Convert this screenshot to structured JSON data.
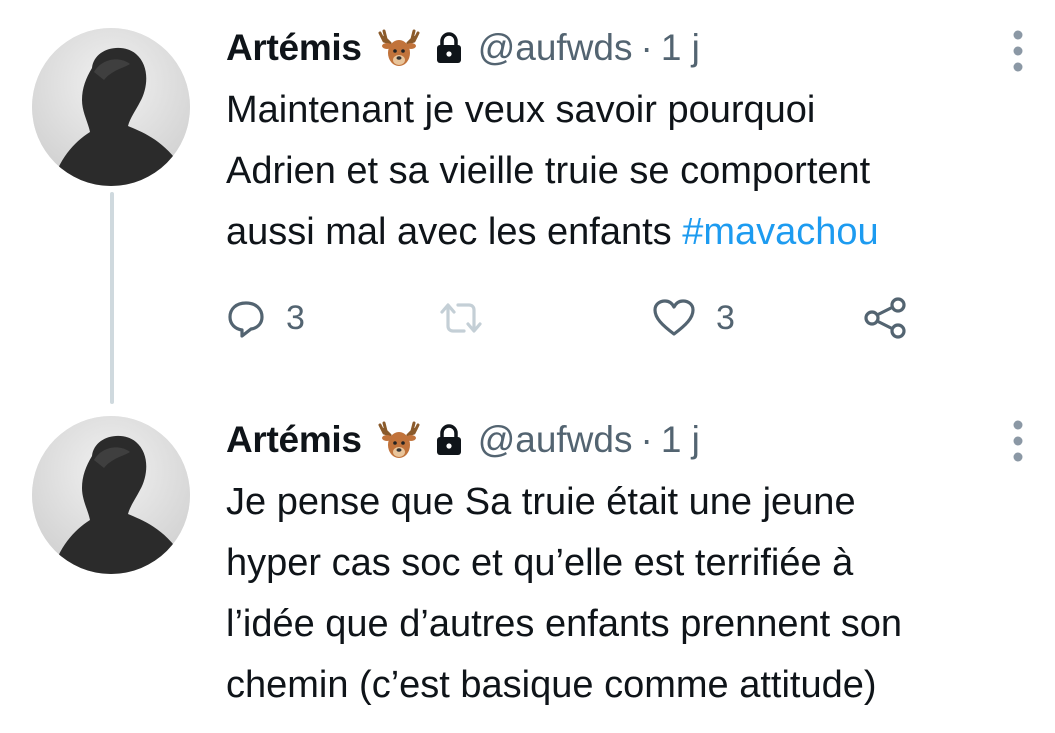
{
  "tweets": [
    {
      "author": {
        "name": "Artémis",
        "handle": "@aufwds",
        "separator": "·",
        "time": "1 j",
        "badge_icon": "deer-emoji",
        "protected_icon": "lock-icon"
      },
      "text_lines": [
        "Maintenant je veux savoir pourquoi",
        "Adrien et sa vieille truie se comportent",
        "aussi mal avec les enfants "
      ],
      "hashtag": "#mavachou",
      "actions": {
        "reply_count": "3",
        "retweet_count": "",
        "like_count": "3"
      }
    },
    {
      "author": {
        "name": "Artémis",
        "handle": "@aufwds",
        "separator": "·",
        "time": "1 j",
        "badge_icon": "deer-emoji",
        "protected_icon": "lock-icon"
      },
      "text_lines": [
        "Je pense que Sa truie était une jeune",
        "hyper cas soc et qu’elle est terrifiée à",
        "l’idée que d’autres enfants prennent son",
        "chemin (c’est basique comme attitude)"
      ]
    }
  ],
  "colors": {
    "text": "#0f1419",
    "secondary": "#536471",
    "link": "#1d9bf0",
    "thread_line": "#cfd9de"
  }
}
